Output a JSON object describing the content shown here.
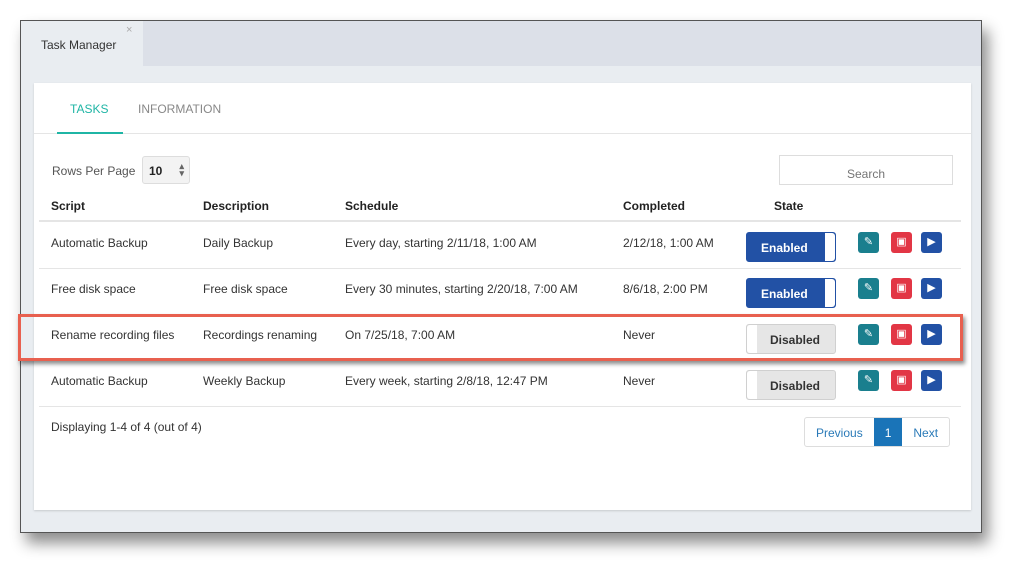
{
  "window": {
    "tab_title": "Task Manager",
    "close_glyph": "×"
  },
  "tabs": [
    {
      "label": "TASKS",
      "active": true
    },
    {
      "label": "INFORMATION",
      "active": false
    }
  ],
  "controls": {
    "rows_per_page_label": "Rows Per Page",
    "rows_per_page_value": "10",
    "select_arrow": "▴▾",
    "search_placeholder": "Search"
  },
  "table": {
    "headers": [
      "Script",
      "Description",
      "Schedule",
      "Completed",
      "State"
    ],
    "rows": [
      {
        "script": "Automatic Backup",
        "description": "Daily Backup",
        "schedule": "Every day, starting 2/11/18, 1:00 AM",
        "completed": "2/12/18, 1:00 AM",
        "state": "Enabled"
      },
      {
        "script": "Free disk space",
        "description": "Free disk space",
        "schedule": "Every 30 minutes, starting 2/20/18, 7:00 AM",
        "completed": "8/6/18, 2:00 PM",
        "state": "Enabled"
      },
      {
        "script": "Rename recording files",
        "description": "Recordings renaming",
        "schedule": "On 7/25/18, 7:00 AM",
        "completed": "Never",
        "state": "Disabled",
        "highlighted": true
      },
      {
        "script": "Automatic Backup",
        "description": "Weekly Backup",
        "schedule": "Every week, starting 2/8/18, 12:47 PM",
        "completed": "Never",
        "state": "Disabled"
      }
    ],
    "action_icons": {
      "edit": "✎",
      "delete": "🗑",
      "run": "▶"
    }
  },
  "footer": {
    "display_text": "Displaying 1-4 of 4 (out of 4)",
    "pagination": {
      "previous": "Previous",
      "current": "1",
      "next": "Next"
    }
  },
  "colors": {
    "accent": "#1fb5a5",
    "enabled": "#2251a5",
    "edit": "#1a7f8e",
    "delete": "#e23645",
    "run": "#2251a5",
    "highlight": "#e8604f"
  }
}
